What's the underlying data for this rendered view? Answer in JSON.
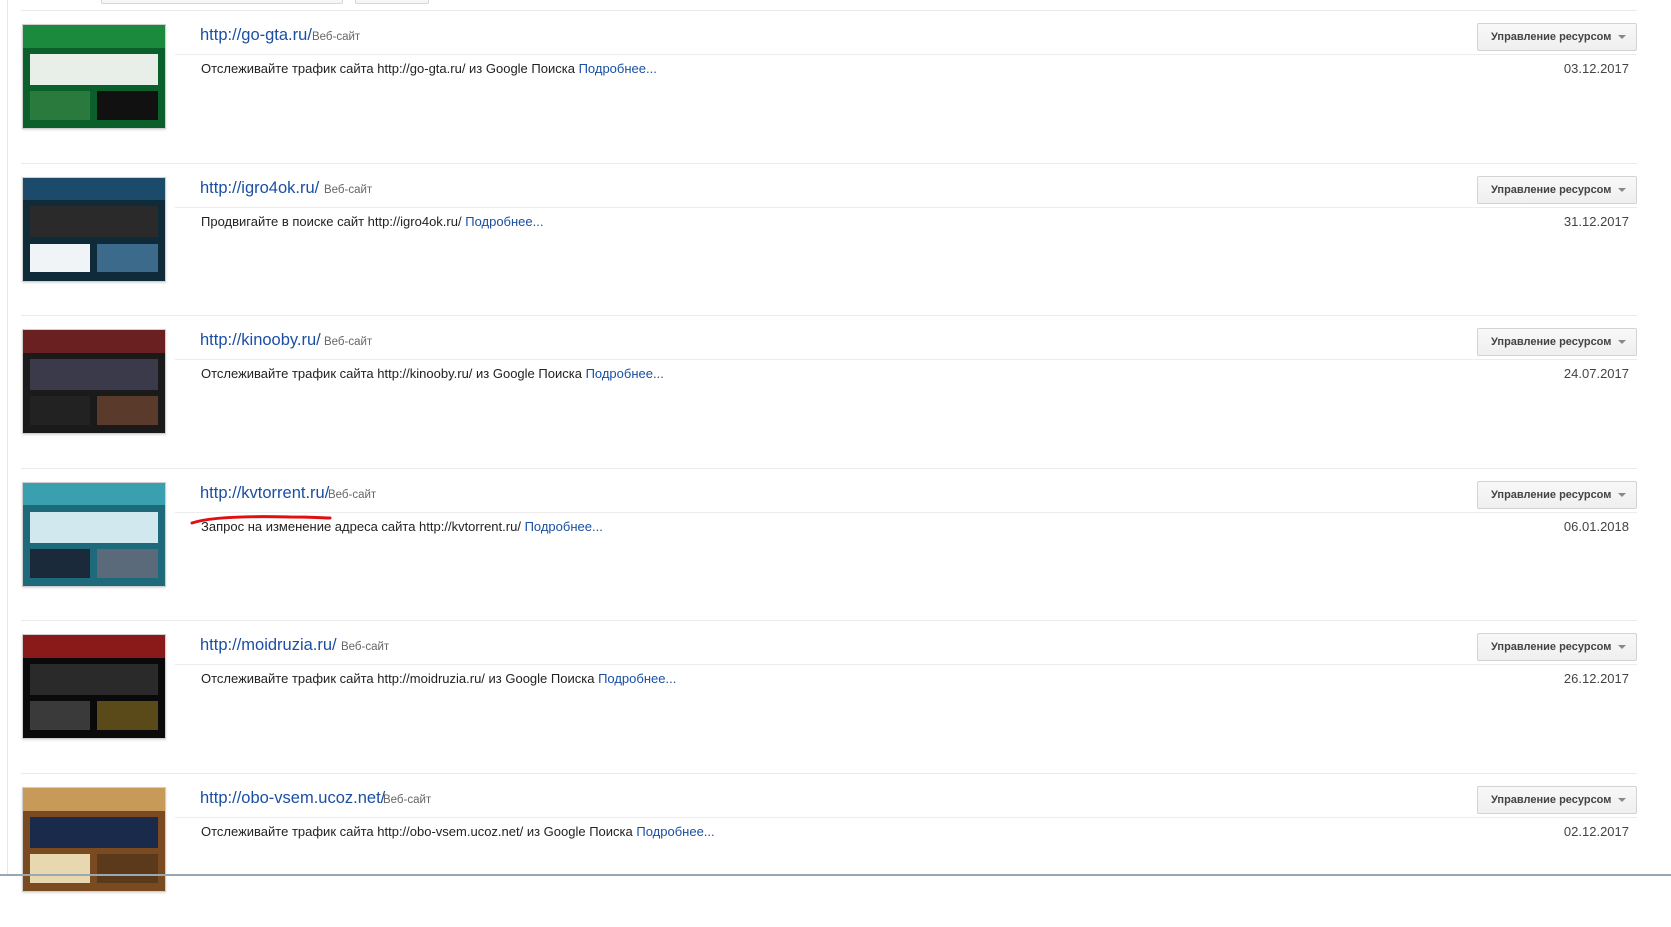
{
  "sites": [
    {
      "url": "http://go-gta.ru/",
      "type_label": "Веб-сайт",
      "description": "Отслеживайте трафик сайта http://go-gta.ru/ из Google Поиска",
      "more_label": "Подробнее...",
      "date": "03.12.2017",
      "manage_label": "Управление ресурсом",
      "thumb_colors": [
        "#0a5f2a",
        "#1c8a3c",
        "#e8efe8",
        "#2a7a3e",
        "#111111"
      ]
    },
    {
      "url": "http://igro4ok.ru/",
      "type_label": "Веб-сайт",
      "description": "Продвигайте в поиске сайт http://igro4ok.ru/",
      "more_label": "Подробнее...",
      "date": "31.12.2017",
      "manage_label": "Управление ресурсом",
      "thumb_colors": [
        "#0f2b3a",
        "#1b4a6a",
        "#2a2a2a",
        "#f0f4f6",
        "#3c6a8a"
      ]
    },
    {
      "url": "http://kinooby.ru/",
      "type_label": "Веб-сайт",
      "description": "Отслеживайте трафик сайта http://kinooby.ru/ из Google Поиска",
      "more_label": "Подробнее...",
      "date": "24.07.2017",
      "manage_label": "Управление ресурсом",
      "thumb_colors": [
        "#1a1a1a",
        "#6a2020",
        "#3a3a4a",
        "#222222",
        "#5a3a2a"
      ]
    },
    {
      "url": "http://kvtorrent.ru/",
      "type_label": "Веб-сайт",
      "description": "Запрос на изменение адреса сайта http://kvtorrent.ru/",
      "more_label": "Подробнее...",
      "date": "06.01.2018",
      "manage_label": "Управление ресурсом",
      "thumb_colors": [
        "#1e6a7a",
        "#3aa0b0",
        "#d0e8ee",
        "#1a2a3a",
        "#5a6a7a"
      ]
    },
    {
      "url": "http://moidruzia.ru/",
      "type_label": "Веб-сайт",
      "description": "Отслеживайте трафик сайта http://moidruzia.ru/ из Google Поиска",
      "more_label": "Подробнее...",
      "date": "26.12.2017",
      "manage_label": "Управление ресурсом",
      "thumb_colors": [
        "#0a0a0a",
        "#8a1a1a",
        "#2a2a2a",
        "#3a3a3a",
        "#5a4a1a"
      ]
    },
    {
      "url": "http://obo-vsem.ucoz.net/",
      "type_label": "Веб-сайт",
      "description": "Отслеживайте трафик сайта http://obo-vsem.ucoz.net/ из Google Поиска",
      "more_label": "Подробнее...",
      "date": "02.12.2017",
      "manage_label": "Управление ресурсом",
      "thumb_colors": [
        "#7a4a20",
        "#c89a5a",
        "#1a2a4a",
        "#e8d8b0",
        "#5a3a1a"
      ]
    }
  ],
  "colors": {
    "link": "#1a4fa3",
    "annotation": "#e01010"
  }
}
